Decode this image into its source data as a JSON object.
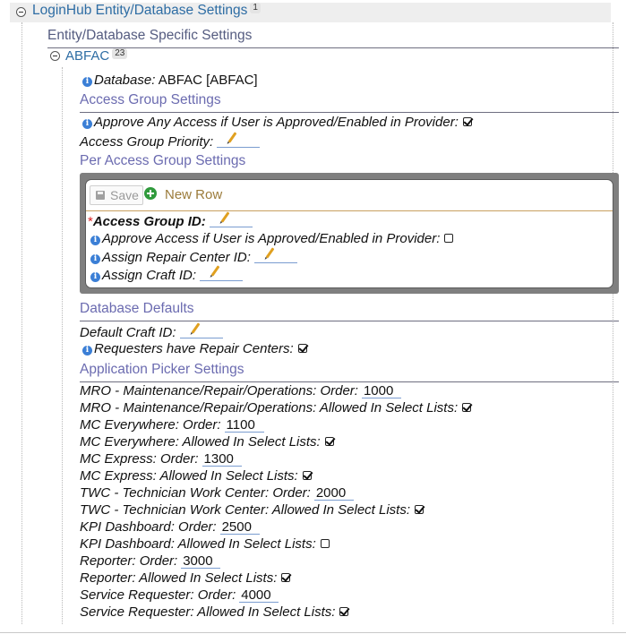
{
  "header": {
    "title": "LoginHub Entity/Database Settings",
    "count": "1"
  },
  "entity_section": {
    "title": "Entity/Database Specific Settings"
  },
  "abfac": {
    "name": "ABFAC",
    "count": "23"
  },
  "database": {
    "label": "Database:",
    "value": "ABFAC [ABFAC]"
  },
  "access_group": {
    "title": "Access Group Settings",
    "approve_label": "Approve Any Access if User is Approved/Enabled in Provider:",
    "approve_checked": true,
    "priority_label": "Access Group Priority:"
  },
  "per_access": {
    "title": "Per Access Group Settings",
    "save_label": "Save",
    "new_row_label": "New Row",
    "access_group_id_label": "Access Group ID:",
    "approve_label": "Approve Access if User is Approved/Enabled in Provider:",
    "approve_checked": false,
    "repair_center_label": "Assign Repair Center ID:",
    "craft_label": "Assign Craft ID:"
  },
  "database_defaults": {
    "title": "Database Defaults",
    "craft_label": "Default Craft ID:",
    "requesters_label": "Requesters have Repair Centers:",
    "requesters_checked": true
  },
  "app_picker": {
    "title": "Application Picker Settings",
    "rows": [
      {
        "label": "MRO - Maintenance/Repair/Operations: Order:",
        "value": "1000"
      },
      {
        "label": "MRO - Maintenance/Repair/Operations: Allowed In Select Lists:",
        "checked": true
      },
      {
        "label": "MC Everywhere: Order:",
        "value": "1100"
      },
      {
        "label": "MC Everywhere: Allowed In Select Lists:",
        "checked": true
      },
      {
        "label": "MC Express: Order:",
        "value": "1300"
      },
      {
        "label": "MC Express: Allowed In Select Lists:",
        "checked": true
      },
      {
        "label": "TWC - Technician Work Center: Order:",
        "value": "2000"
      },
      {
        "label": "TWC - Technician Work Center: Allowed In Select Lists:",
        "checked": true
      },
      {
        "label": "KPI Dashboard: Order:",
        "value": "2500"
      },
      {
        "label": "KPI Dashboard: Allowed In Select Lists:",
        "checked": false
      },
      {
        "label": "Reporter: Order:",
        "value": "3000"
      },
      {
        "label": "Reporter: Allowed In Select Lists:",
        "checked": true
      },
      {
        "label": "Service Requester: Order:",
        "value": "4000"
      },
      {
        "label": "Service Requester: Allowed In Select Lists:",
        "checked": true
      }
    ]
  },
  "colors": {
    "link": "#2e6da4",
    "section_heading": "#6b6bb0",
    "new_row": "#9b7b3a",
    "add_icon": "#2f9a3c"
  }
}
